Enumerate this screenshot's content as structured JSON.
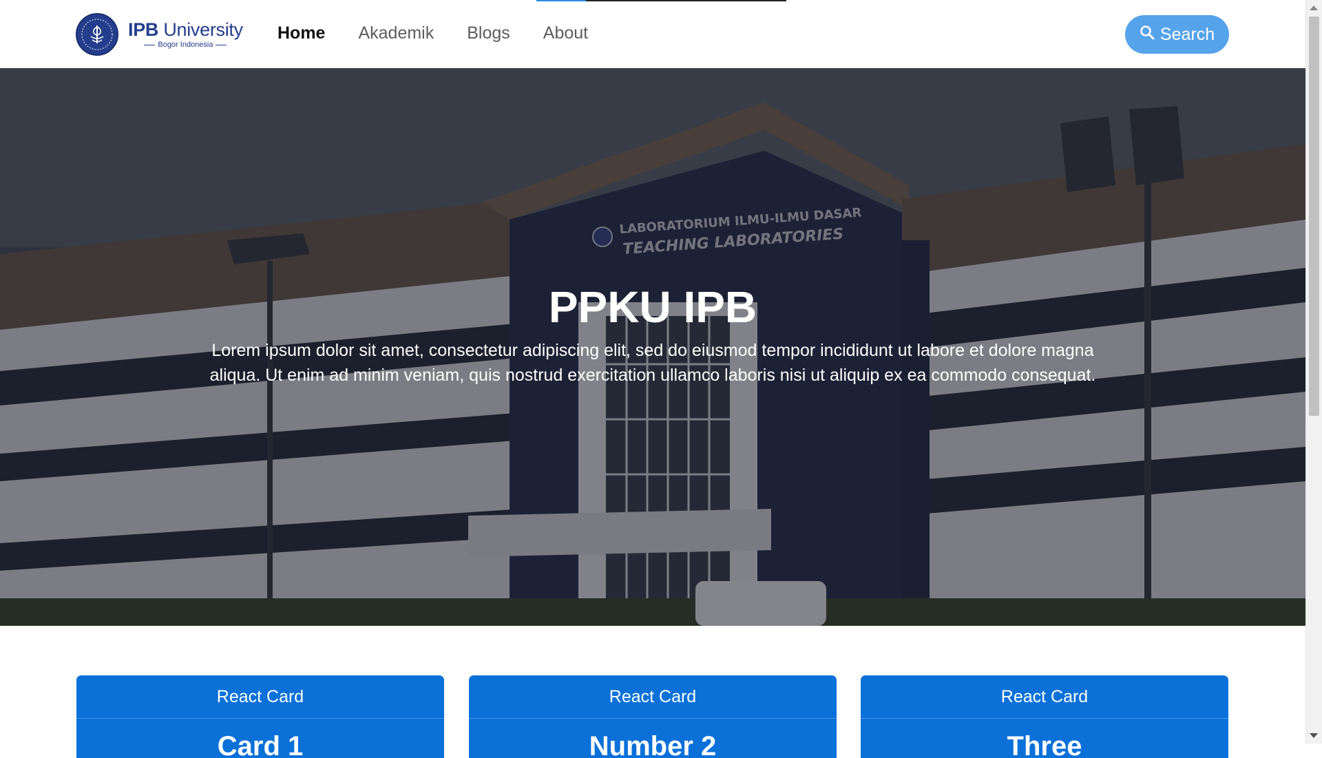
{
  "navbar": {
    "logo": {
      "title_bold": "IPB",
      "title_rest": "University",
      "subtitle": "Bogor Indonesia"
    },
    "links": [
      {
        "label": "Home",
        "active": true
      },
      {
        "label": "Akademik",
        "active": false
      },
      {
        "label": "Blogs",
        "active": false
      },
      {
        "label": "About",
        "active": false
      }
    ],
    "search_label": "Search",
    "search_icon": "search-icon"
  },
  "hero": {
    "title": "PPKU IPB",
    "text": "Lorem ipsum dolor sit amet, consectetur adipiscing elit, sed do eiusmod tempor incididunt ut labore et dolore magna aliqua. Ut enim ad minim veniam, quis nostrud exercitation ullamco laboris nisi ut aliquip ex ea commodo consequat.",
    "building_sign": [
      "LABORATORIUM ILMU-ILMU DASAR",
      "TEACHING LABORATORIES"
    ]
  },
  "cards": [
    {
      "header": "React Card",
      "title": "Card 1"
    },
    {
      "header": "React Card",
      "title": "Number 2"
    },
    {
      "header": "React Card",
      "title": "Three"
    }
  ],
  "colors": {
    "brand_navy": "#243d8c",
    "accent_blue": "#0b71d9",
    "search_button": "#55a3ea"
  }
}
